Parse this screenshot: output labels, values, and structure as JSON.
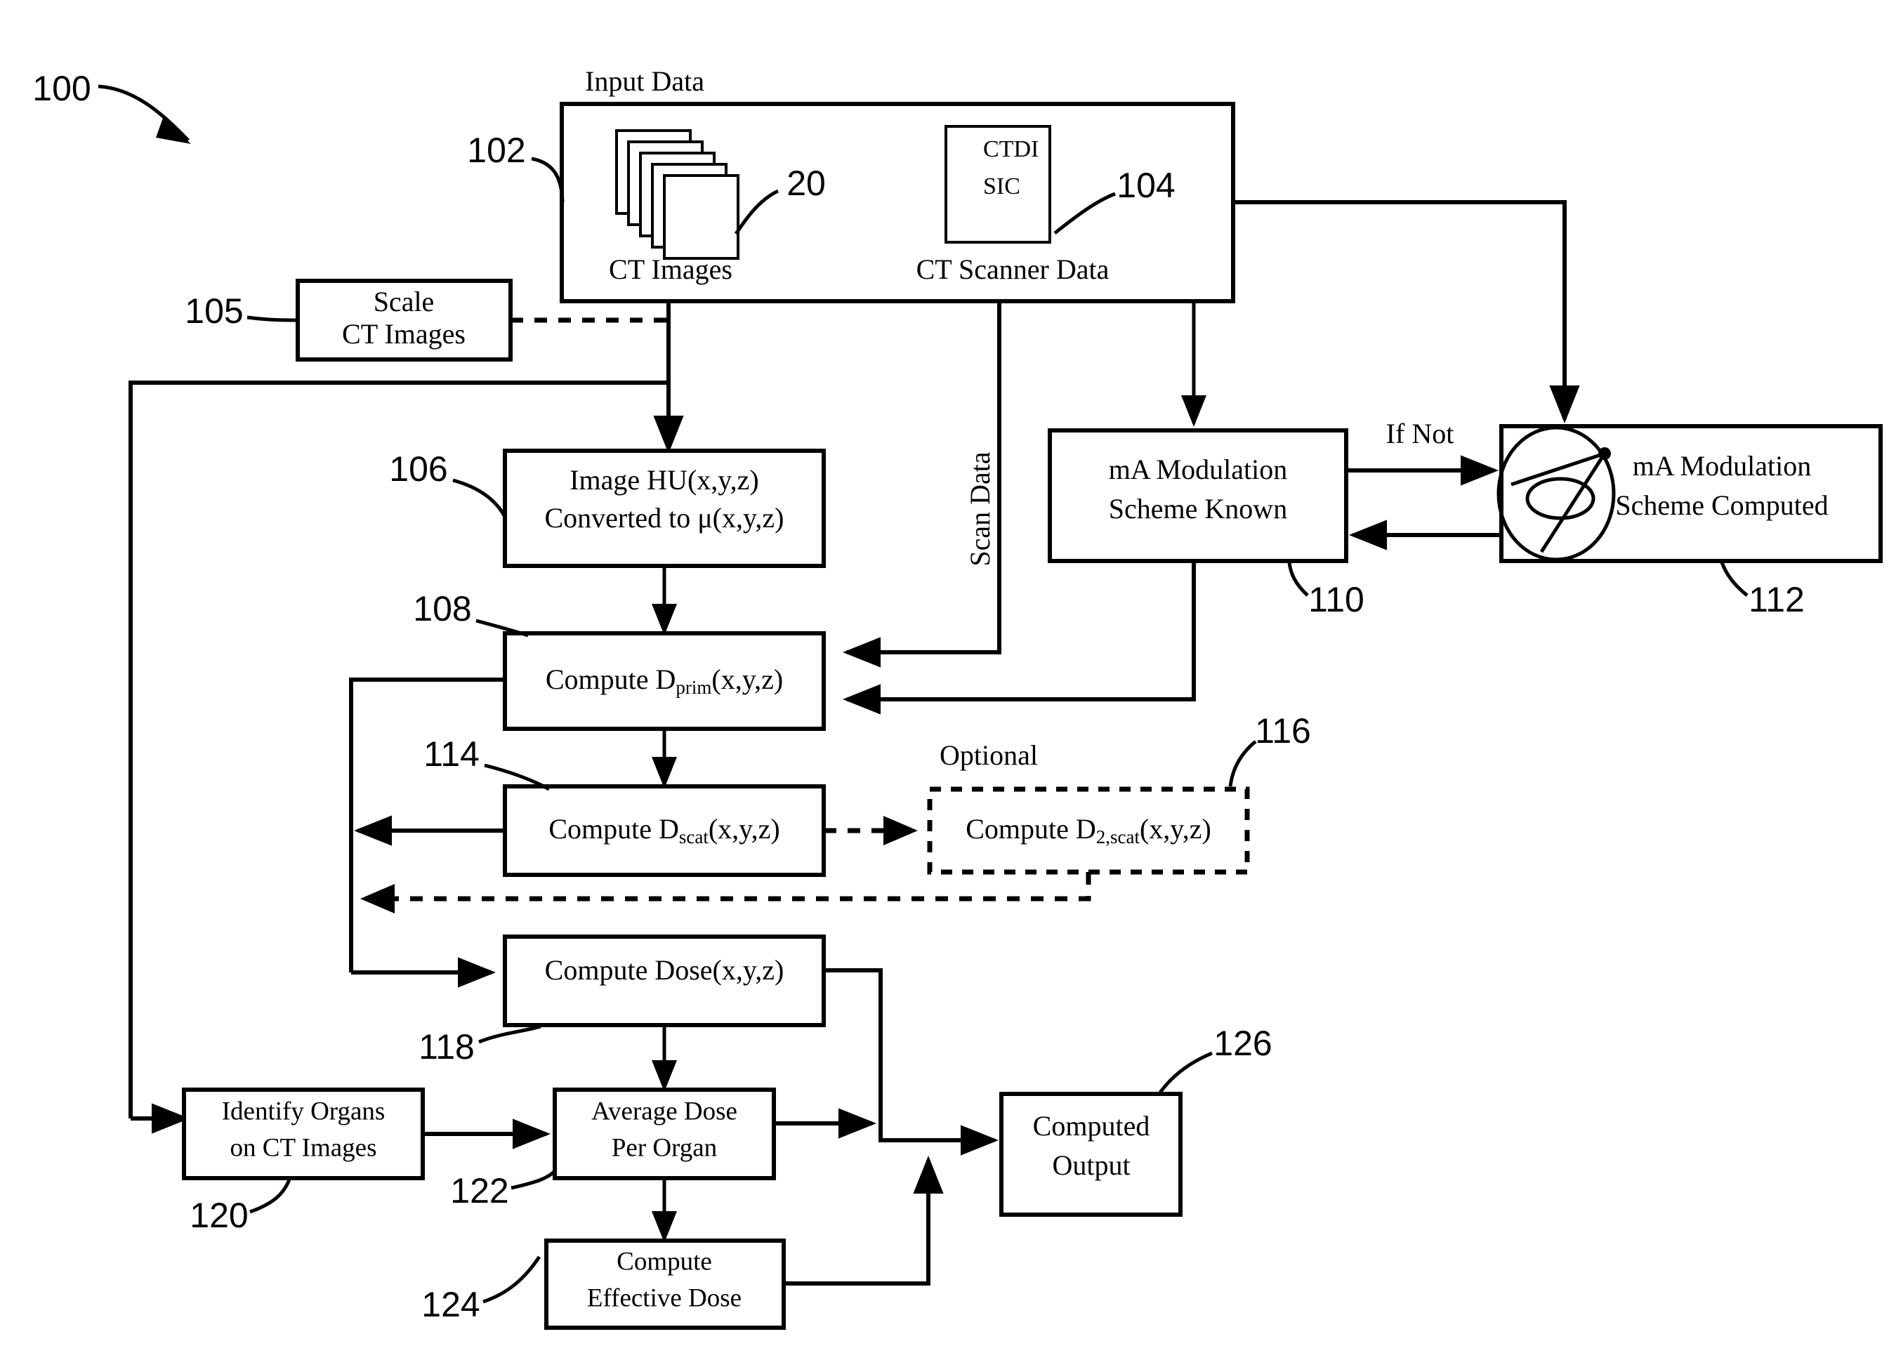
{
  "figure": {
    "figure_ref": "100",
    "title_group": "Input Data",
    "refs": {
      "r100": "100",
      "r102": "102",
      "r104": "104",
      "r105": "105",
      "r106": "106",
      "r108": "108",
      "r110": "110",
      "r112": "112",
      "r114": "114",
      "r116": "116",
      "r118": "118",
      "r120": "120",
      "r122": "122",
      "r124": "124",
      "r126": "126",
      "r20": "20"
    },
    "input_data": {
      "group_title": "Input Data",
      "ct_images_label": "CT Images",
      "ct_images_ref": "20",
      "scanner_data_label": "CT Scanner Data",
      "scanner_data_ref": "104",
      "scanner_lines": [
        "CTDI",
        "SIC"
      ],
      "icon_ct_stack": "ct-image-stack-icon",
      "icon_scanner_card": "scanner-data-card-icon"
    },
    "boxes": {
      "scale_ct": {
        "line1": "Scale",
        "line2": "CT Images",
        "ref": "105"
      },
      "image_hu": {
        "line1": "Image HU(x,y,z)",
        "line2": "Converted to μ(x,y,z)",
        "ref": "106"
      },
      "compute_dprim": {
        "text_pre": "Compute D",
        "text_sub": "prim",
        "text_post": "(x,y,z)",
        "ref": "108"
      },
      "compute_dscat": {
        "text_pre": "Compute D",
        "text_sub": "scat",
        "text_post": "(x,y,z)",
        "ref": "114"
      },
      "compute_d2scat": {
        "text_pre": "Compute D",
        "text_sub": "2,scat",
        "text_post": "(x,y,z)",
        "ref": "116",
        "badge": "Optional"
      },
      "compute_dose": {
        "text": "Compute Dose(x,y,z)",
        "ref": "118"
      },
      "ma_known": {
        "line1": "mA Modulation",
        "line2": "Scheme Known",
        "ref": "110"
      },
      "ma_computed": {
        "line1": "mA Modulation",
        "line2": "Scheme Computed",
        "ref": "112",
        "icon": "ct-gantry-icon"
      },
      "identify_organs": {
        "line1": "Identify Organs",
        "line2": "on CT Images",
        "ref": "120"
      },
      "average_dose": {
        "line1": "Average Dose",
        "line2": "Per Organ",
        "ref": "122"
      },
      "effective_dose": {
        "line1": "Compute",
        "line2": "Effective Dose",
        "ref": "124"
      },
      "computed_output": {
        "line1": "Computed",
        "line2": "Output",
        "ref": "126"
      }
    },
    "edge_labels": {
      "scan_data": "Scan Data",
      "if_not": "If Not",
      "optional": "Optional"
    },
    "colors": {
      "ink": "#000000",
      "paper": "#ffffff"
    }
  }
}
